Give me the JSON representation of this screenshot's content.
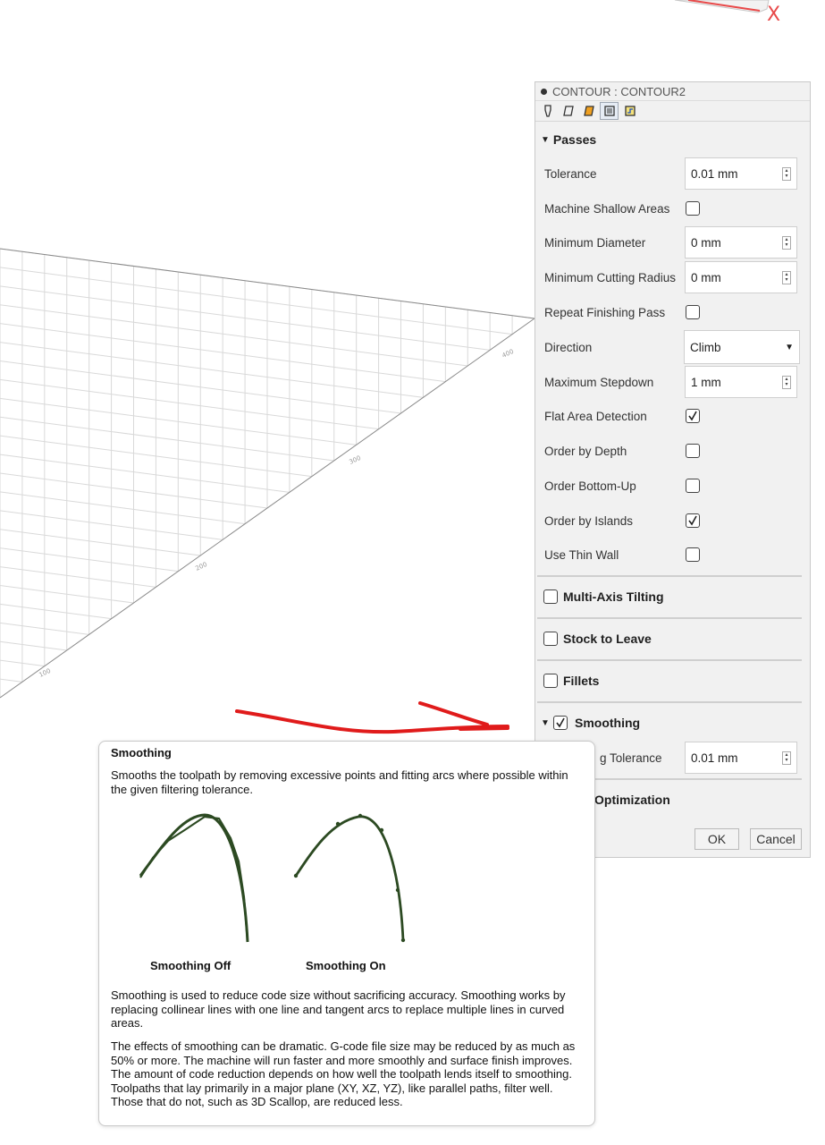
{
  "axis_label": "X",
  "panel": {
    "title": "CONTOUR : CONTOUR2",
    "tabs": [
      "tool-icon",
      "geometry-icon",
      "heights-icon",
      "passes-icon",
      "linking-icon"
    ],
    "section": "Passes",
    "fields": {
      "tolerance": {
        "label": "Tolerance",
        "value": "0.01 mm"
      },
      "machine_shallow": {
        "label": "Machine Shallow Areas",
        "checked": false
      },
      "min_diameter": {
        "label": "Minimum Diameter",
        "value": "0 mm"
      },
      "min_cutting_radius": {
        "label": "Minimum Cutting Radius",
        "value": "0 mm"
      },
      "repeat_finishing": {
        "label": "Repeat Finishing Pass",
        "checked": false
      },
      "direction": {
        "label": "Direction",
        "value": "Climb"
      },
      "max_stepdown": {
        "label": "Maximum Stepdown",
        "value": "1 mm"
      },
      "flat_area": {
        "label": "Flat Area Detection",
        "checked": true
      },
      "order_depth": {
        "label": "Order by Depth",
        "checked": false
      },
      "order_bottom_up": {
        "label": "Order Bottom-Up",
        "checked": false
      },
      "order_islands": {
        "label": "Order by Islands",
        "checked": true
      },
      "thin_wall": {
        "label": "Use Thin Wall",
        "checked": false
      }
    },
    "groups": {
      "multi_axis": "Multi-Axis Tilting",
      "stock_to_leave": "Stock to Leave",
      "fillets": "Fillets",
      "smoothing": "Smoothing"
    },
    "smoothing_tolerance": {
      "label_visible": "g Tolerance",
      "value": "0.01 mm"
    },
    "optimization_visible": "Optimization",
    "ok": "OK",
    "cancel": "Cancel"
  },
  "tooltip": {
    "title": "Smoothing",
    "intro": "Smooths the toolpath by removing excessive points and fitting arcs where possible within the given filtering tolerance.",
    "caption_off": "Smoothing Off",
    "caption_on": "Smoothing On",
    "para1": "Smoothing is used to reduce code size without sacrificing accuracy. Smoothing works by replacing collinear lines with one line and tangent arcs to replace multiple lines in curved areas.",
    "para2": "The effects of smoothing can be dramatic. G-code file size may be reduced by as much as 50% or more. The machine will run faster and more smoothly and surface finish improves. The amount of code reduction depends on how well the toolpath lends itself to smoothing. Toolpaths that lay primarily in a major plane (XY, XZ, YZ), like parallel paths, filter well. Those that do not, such as 3D Scallop, are reduced less."
  },
  "grid_labels": [
    "400",
    "300",
    "200",
    "100"
  ],
  "colors": {
    "annotation_arrow": "#e01b1b",
    "curve": "#2c4a22",
    "axis_x": "#e84a4a"
  }
}
